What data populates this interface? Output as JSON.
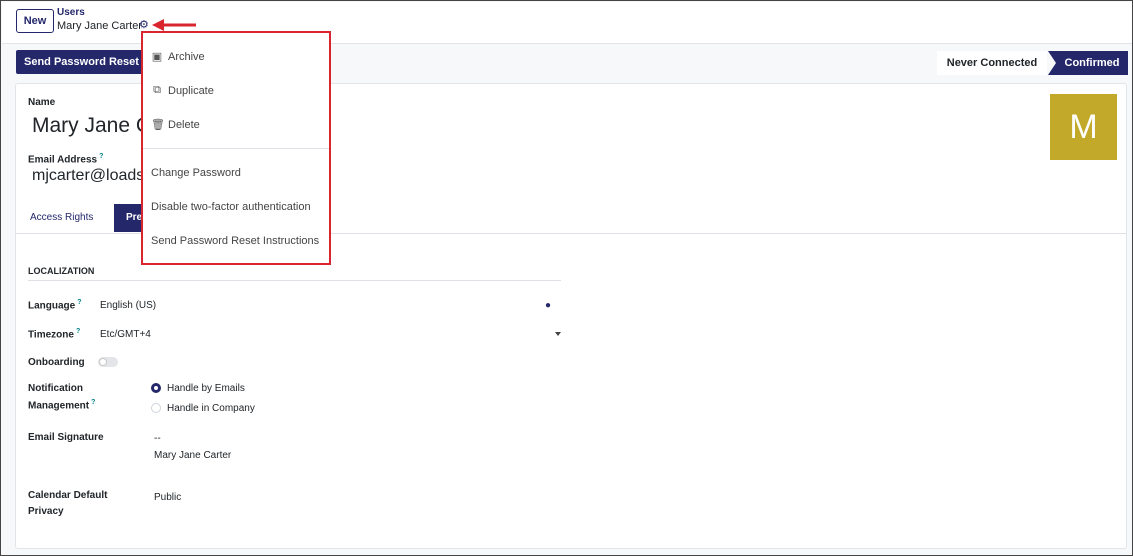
{
  "breadcrumb": {
    "parent": "Users",
    "current": "Mary Jane Carter"
  },
  "toolbar": {
    "new_label": "New"
  },
  "statusbar": {
    "reset_button": "Send Password Reset Instructions",
    "stages": [
      "Never Connected",
      "Confirmed"
    ],
    "active_stage": "Confirmed"
  },
  "form": {
    "name_label": "Name",
    "name_value": "Mary Jane Carter",
    "email_label": "Email Address",
    "email_value": "mjcarter@loadsoft.com",
    "avatar_initial": "M",
    "tabs": [
      "Access Rights",
      "Preferences"
    ]
  },
  "localization": {
    "section_title": "LOCALIZATION",
    "language_label": "Language",
    "language_value": "English (US)",
    "timezone_label": "Timezone",
    "timezone_value": "Etc/GMT+4",
    "onboarding_label": "Onboarding",
    "notification_label_1": "Notification",
    "notification_label_2": "Management",
    "notification_options": [
      "Handle by Emails",
      "Handle in Company"
    ],
    "notification_selected": "Handle by Emails",
    "signature_label": "Email Signature",
    "signature_line1": "--",
    "signature_line2": "Mary Jane Carter",
    "privacy_label_1": "Calendar Default",
    "privacy_label_2": "Privacy",
    "privacy_value": "Public"
  },
  "help_marker": "?",
  "actions_menu": {
    "items": [
      {
        "label": "Archive",
        "icon": "inbox-icon"
      },
      {
        "label": "Duplicate",
        "icon": "copy-icon"
      },
      {
        "label": "Delete",
        "icon": "trash-icon"
      },
      {
        "label": "Change Password"
      },
      {
        "label": "Disable two-factor authentication"
      },
      {
        "label": "Send Password Reset Instructions"
      }
    ]
  },
  "colors": {
    "accent": "#24286b",
    "highlight_box": "#d9262e",
    "avatar_bg": "#c2a929"
  }
}
